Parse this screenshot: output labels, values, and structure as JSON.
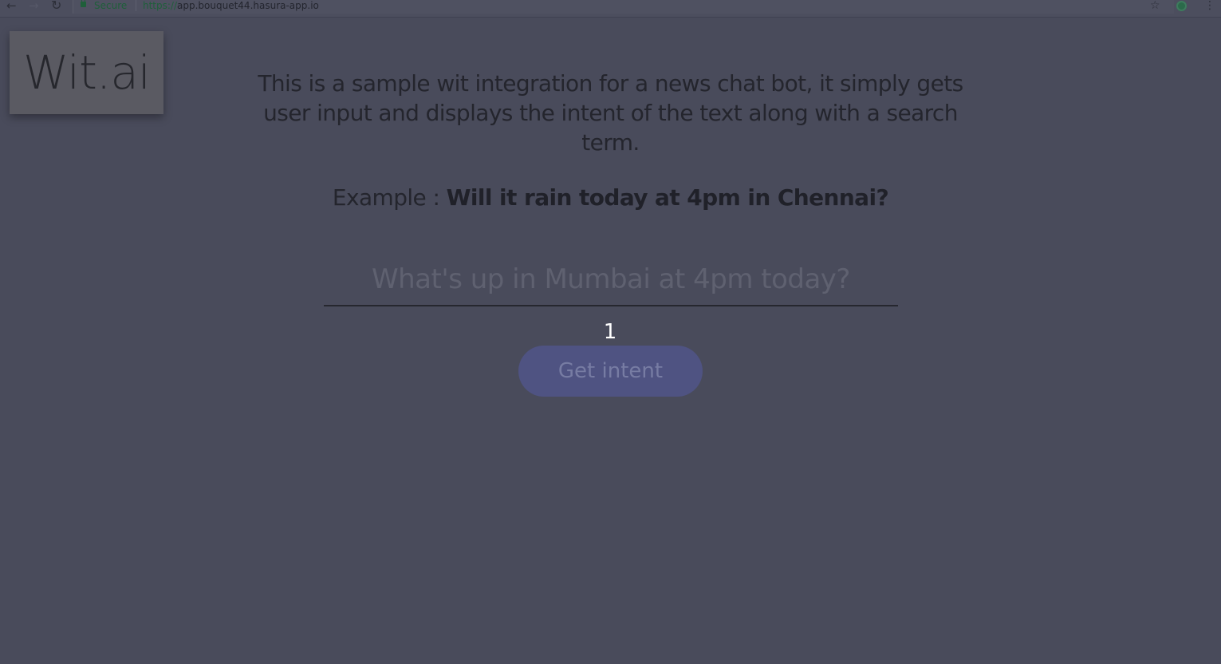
{
  "browser": {
    "back_icon": "←",
    "forward_icon": "→",
    "reload_icon": "↻",
    "secure_label": "Secure",
    "url_scheme": "https://",
    "url_host": "app.bouquet44.hasura-app.io",
    "star_icon": "☆",
    "menu_icon": "⋮"
  },
  "logo": {
    "text": "Wit.ai"
  },
  "intro": {
    "description": "This is a sample wit integration for a news chat bot, it simply gets user input and displays the intent of the text along with a search term.",
    "example_label": "Example : ",
    "example_query": "Will it rain today at 4pm in Chennai?"
  },
  "search": {
    "placeholder": "What's up in Mumbai at 4pm today?",
    "value": ""
  },
  "counter": {
    "value": "1"
  },
  "actions": {
    "get_intent_label": "Get intent"
  },
  "colors": {
    "background": "#494b5b",
    "button": "#4f5382",
    "logo_background": "#5a5a62"
  }
}
